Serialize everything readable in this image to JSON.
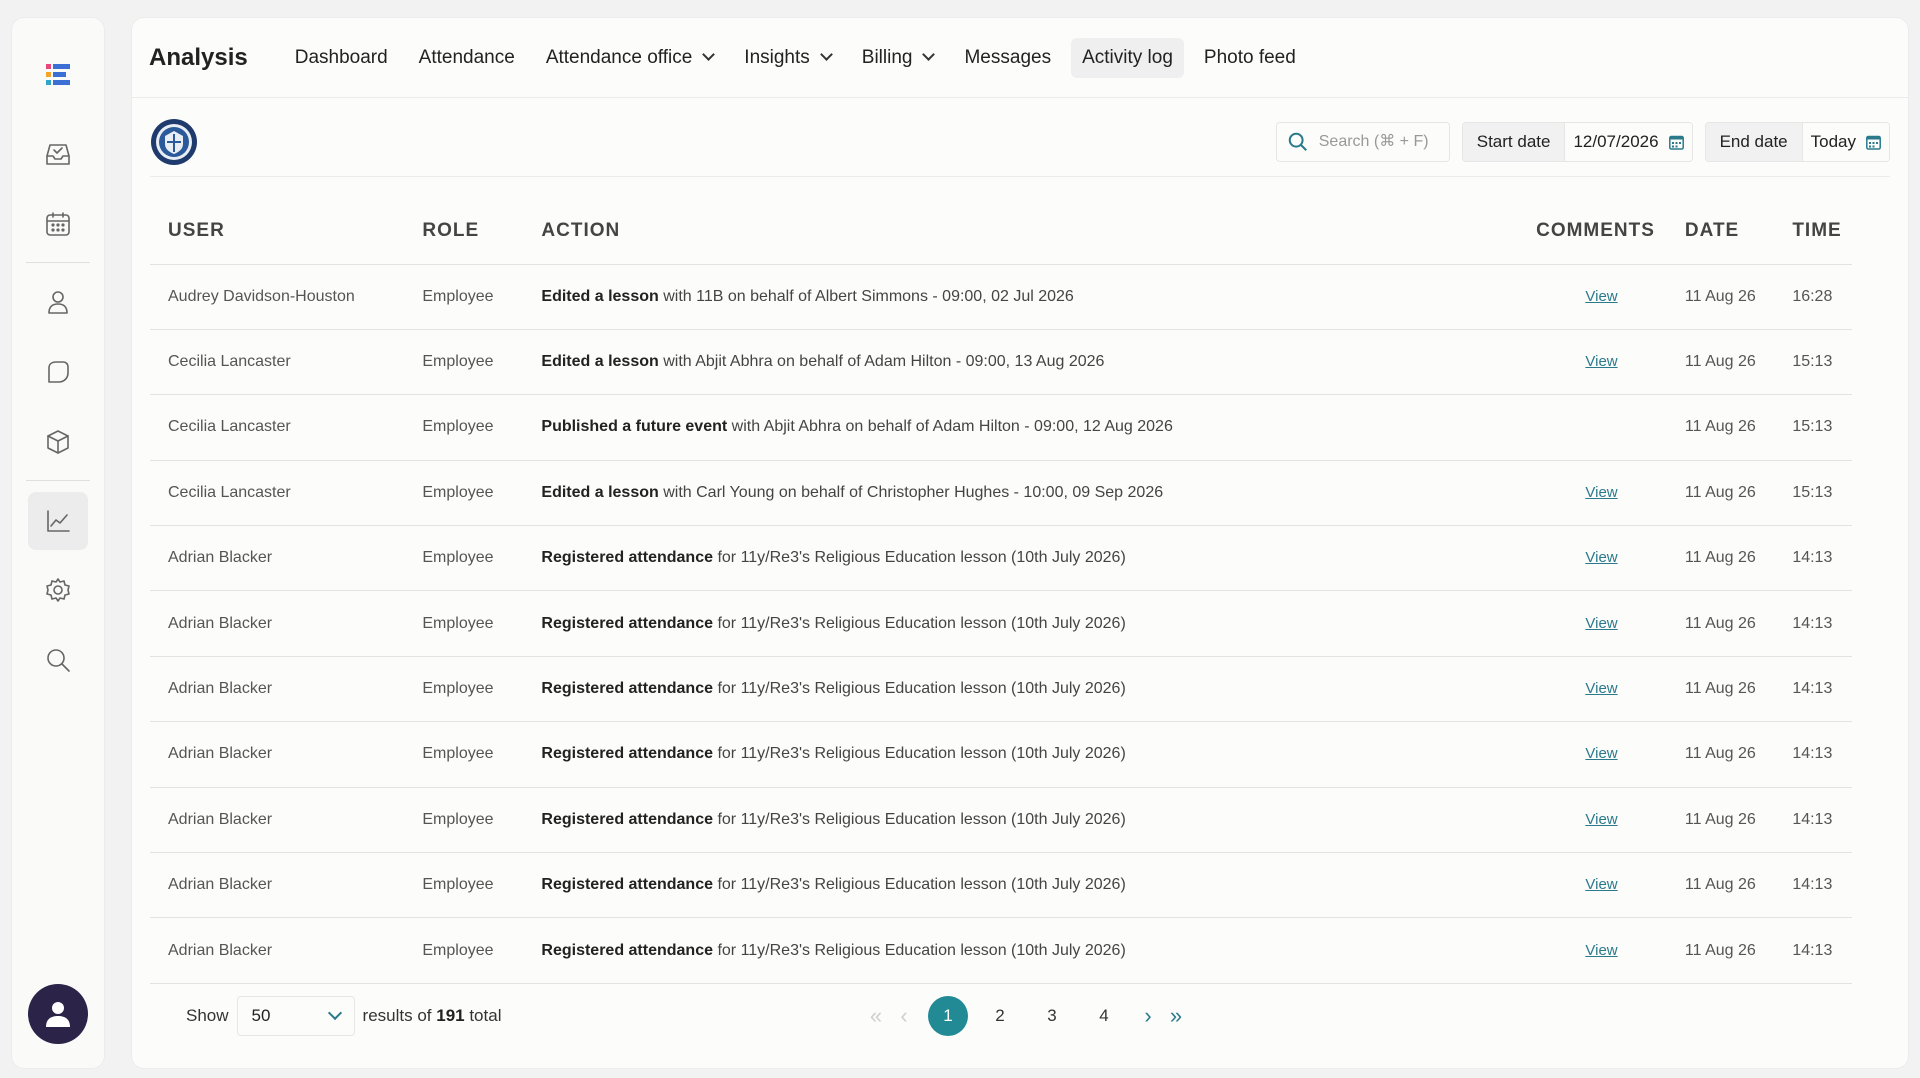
{
  "nav": {
    "brand": "Analysis",
    "items": [
      {
        "label": "Dashboard",
        "dropdown": false,
        "active": false
      },
      {
        "label": "Attendance",
        "dropdown": false,
        "active": false
      },
      {
        "label": "Attendance office",
        "dropdown": true,
        "active": false
      },
      {
        "label": "Insights",
        "dropdown": true,
        "active": false
      },
      {
        "label": "Billing",
        "dropdown": true,
        "active": false
      },
      {
        "label": "Messages",
        "dropdown": false,
        "active": false
      },
      {
        "label": "Activity log",
        "dropdown": false,
        "active": true
      },
      {
        "label": "Photo feed",
        "dropdown": false,
        "active": false
      }
    ]
  },
  "sidebar": {
    "icons": [
      "inbox-check-icon",
      "calendar-icon",
      "user-icon",
      "chat-icon",
      "box-icon",
      "chart-icon",
      "gear-icon",
      "search-icon"
    ],
    "active": "chart-icon"
  },
  "toolbar": {
    "search_placeholder": "Search (⌘ + F)",
    "start_label": "Start date",
    "start_value": "12/07/2026",
    "end_label": "End date",
    "end_value": "Today"
  },
  "table": {
    "headers": {
      "user": "USER",
      "role": "ROLE",
      "action": "ACTION",
      "comments": "COMMENTS",
      "date": "DATE",
      "time": "TIME"
    },
    "rows": [
      {
        "user": "Audrey Davidson-Houston",
        "role": "Employee",
        "action_bold": "Edited a lesson",
        "action_rest": " with 11B on behalf of Albert Simmons - 09:00, 02 Jul 2026",
        "comment": "View",
        "date": "11 Aug 26",
        "time": "16:28"
      },
      {
        "user": "Cecilia Lancaster",
        "role": "Employee",
        "action_bold": "Edited a lesson",
        "action_rest": " with Abjit Abhra on behalf of Adam Hilton - 09:00, 13 Aug 2026",
        "comment": "View",
        "date": "11 Aug 26",
        "time": "15:13"
      },
      {
        "user": "Cecilia Lancaster",
        "role": "Employee",
        "action_bold": "Published a future event",
        "action_rest": " with Abjit Abhra on behalf of Adam Hilton - 09:00, 12 Aug 2026",
        "comment": "",
        "date": "11 Aug 26",
        "time": "15:13"
      },
      {
        "user": "Cecilia Lancaster",
        "role": "Employee",
        "action_bold": "Edited a lesson",
        "action_rest": " with Carl Young on behalf of Christopher Hughes - 10:00, 09 Sep 2026",
        "comment": "View",
        "date": "11 Aug 26",
        "time": "15:13"
      },
      {
        "user": "Adrian Blacker",
        "role": "Employee",
        "action_bold": "Registered attendance",
        "action_rest": " for 11y/Re3's Religious Education lesson (10th July 2026)",
        "comment": "View",
        "date": "11 Aug 26",
        "time": "14:13"
      },
      {
        "user": "Adrian Blacker",
        "role": "Employee",
        "action_bold": "Registered attendance",
        "action_rest": " for 11y/Re3's Religious Education lesson (10th July 2026)",
        "comment": "View",
        "date": "11 Aug 26",
        "time": "14:13"
      },
      {
        "user": "Adrian Blacker",
        "role": "Employee",
        "action_bold": "Registered attendance",
        "action_rest": " for 11y/Re3's Religious Education lesson (10th July 2026)",
        "comment": "View",
        "date": "11 Aug 26",
        "time": "14:13"
      },
      {
        "user": "Adrian Blacker",
        "role": "Employee",
        "action_bold": "Registered attendance",
        "action_rest": " for 11y/Re3's Religious Education lesson (10th July 2026)",
        "comment": "View",
        "date": "11 Aug 26",
        "time": "14:13"
      },
      {
        "user": "Adrian Blacker",
        "role": "Employee",
        "action_bold": "Registered attendance",
        "action_rest": " for 11y/Re3's Religious Education lesson (10th July 2026)",
        "comment": "View",
        "date": "11 Aug 26",
        "time": "14:13"
      },
      {
        "user": "Adrian Blacker",
        "role": "Employee",
        "action_bold": "Registered attendance",
        "action_rest": " for 11y/Re3's Religious Education lesson (10th July 2026)",
        "comment": "View",
        "date": "11 Aug 26",
        "time": "14:13"
      },
      {
        "user": "Adrian Blacker",
        "role": "Employee",
        "action_bold": "Registered attendance",
        "action_rest": " for 11y/Re3's Religious Education lesson (10th July 2026)",
        "comment": "View",
        "date": "11 Aug 26",
        "time": "14:13"
      }
    ]
  },
  "footer": {
    "show_label": "Show",
    "page_size": "50",
    "results_prefix": "results of ",
    "total": "191",
    "results_suffix": " total"
  },
  "pagination": {
    "pages": [
      "1",
      "2",
      "3",
      "4"
    ],
    "current": "1"
  },
  "colors": {
    "accent": "#218a95",
    "link": "#2a7a8c",
    "avatar": "#2b2348"
  }
}
